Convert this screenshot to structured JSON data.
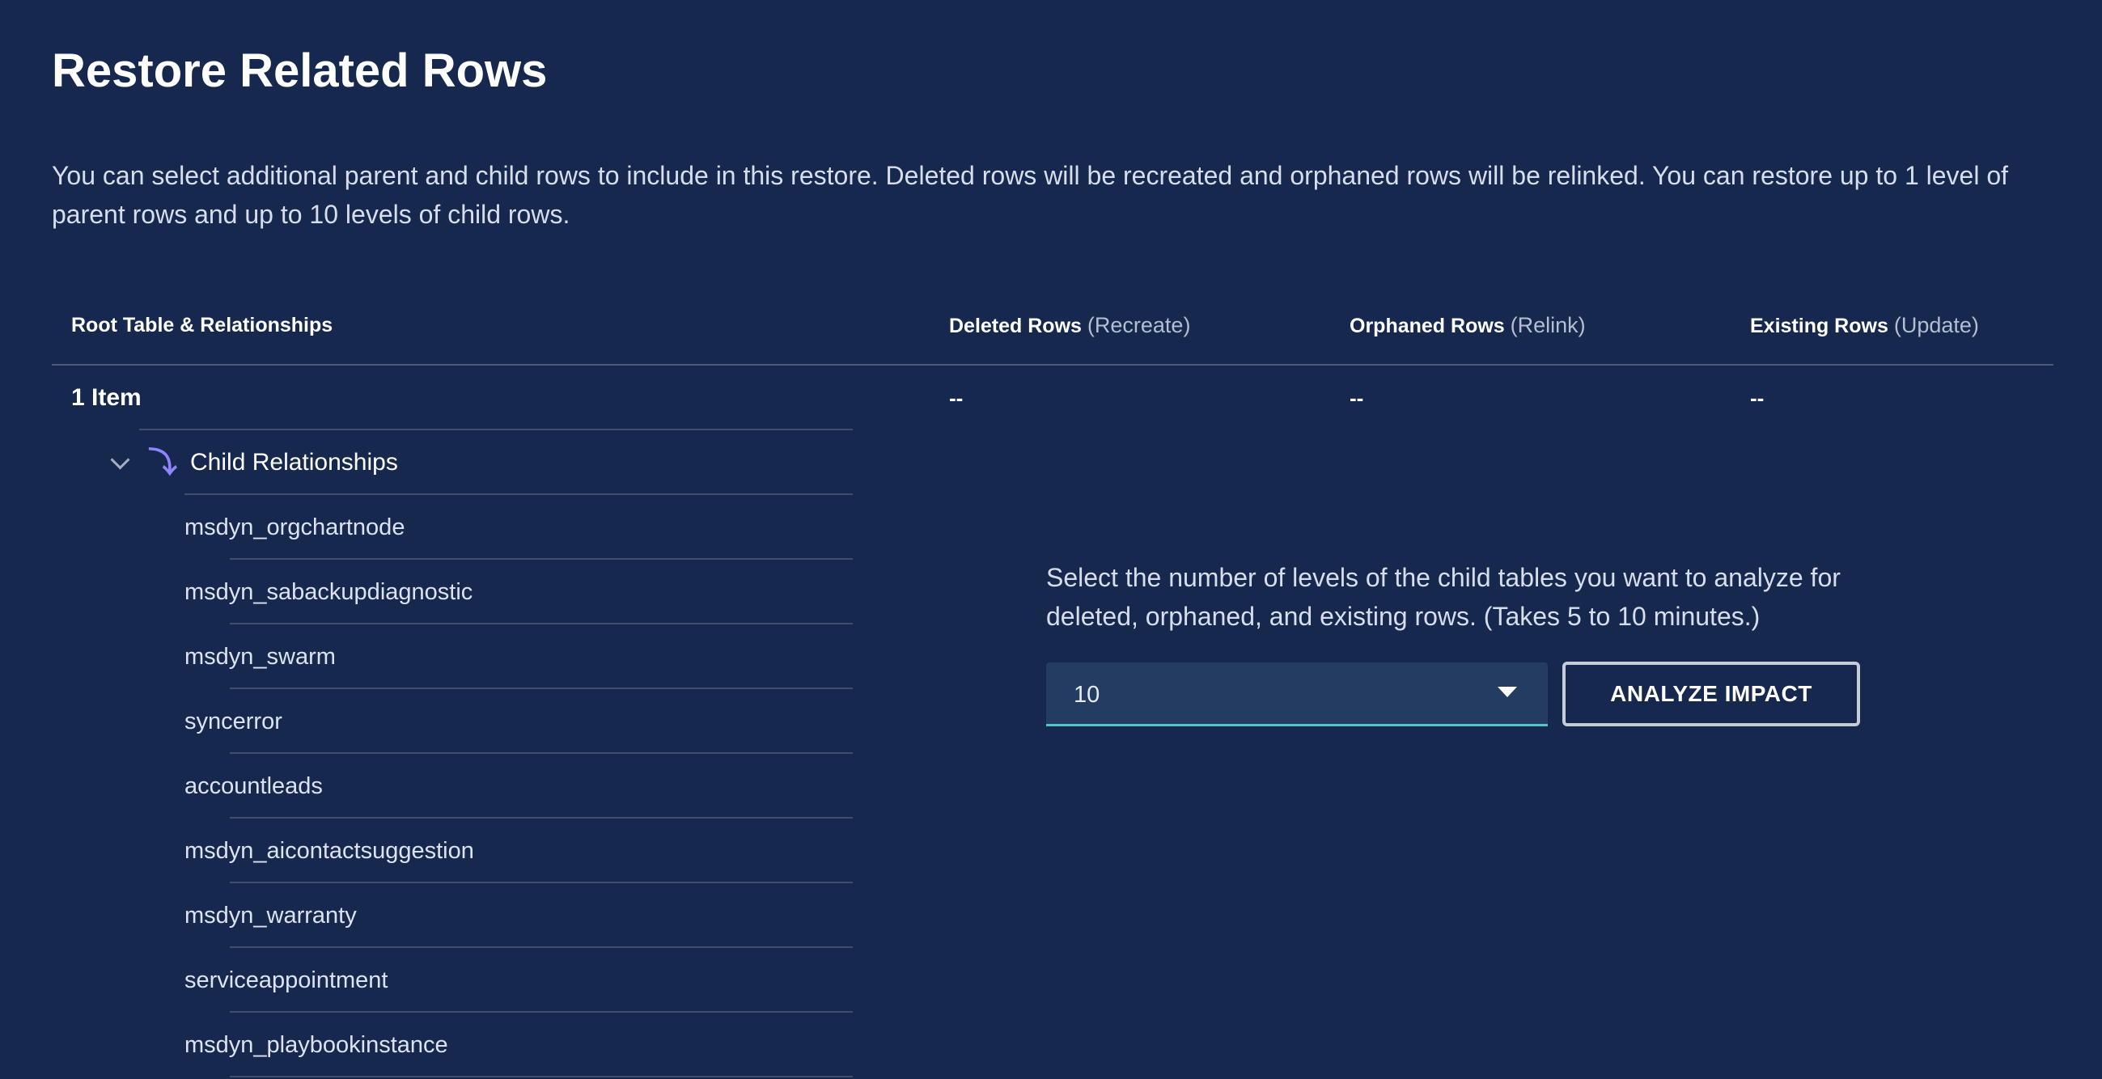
{
  "page": {
    "title": "Restore Related Rows",
    "description": "You can select additional parent and child rows to include in this restore. Deleted rows will be recreated and orphaned rows will be relinked. You can restore up to 1 level of parent rows and up to 10 levels of child rows."
  },
  "table": {
    "columns": {
      "root": "Root Table & Relationships",
      "deleted": {
        "label": "Deleted Rows",
        "sub": "(Recreate)"
      },
      "orphaned": {
        "label": "Orphaned Rows",
        "sub": "(Relink)"
      },
      "existing": {
        "label": "Existing Rows",
        "sub": "(Update)"
      }
    },
    "root_row": {
      "label": "1 Item",
      "deleted": "--",
      "orphaned": "--",
      "existing": "--"
    },
    "child_group": {
      "label": "Child Relationships",
      "expanded": true,
      "icons": {
        "toggle": "chevron-down-icon",
        "relation": "child-arrow-icon"
      },
      "items": [
        "msdyn_orgchartnode",
        "msdyn_sabackupdiagnostic",
        "msdyn_swarm",
        "syncerror",
        "accountleads",
        "msdyn_aicontactsuggestion",
        "msdyn_warranty",
        "serviceappointment",
        "msdyn_playbookinstance"
      ]
    }
  },
  "analyze": {
    "prompt": "Select the number of levels of the child tables you want to analyze for deleted, orphaned, and existing rows. (Takes 5 to 10 minutes.)",
    "levels_value": "10",
    "button_label": "ANALYZE IMPACT"
  },
  "colors": {
    "background": "#16284d",
    "accent_underline": "#4fc7c7",
    "child_arrow": "#8f84ff"
  }
}
